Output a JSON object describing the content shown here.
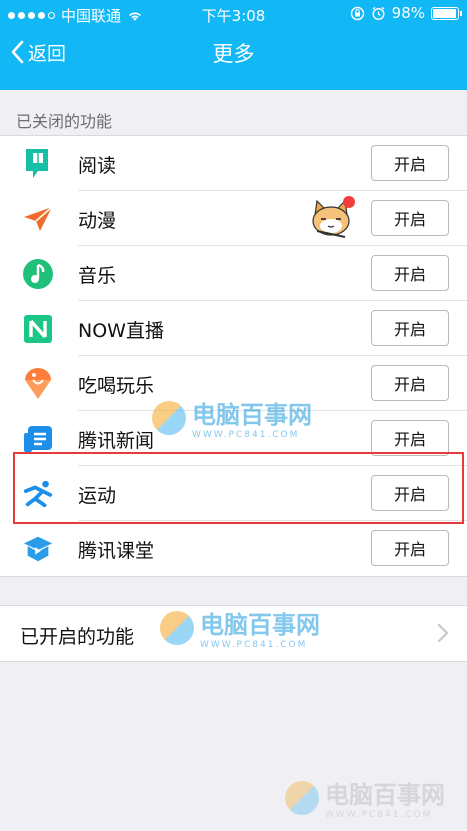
{
  "status": {
    "carrier": "中国联通",
    "time": "下午3:08",
    "battery": "98%",
    "battery_level": 0.98
  },
  "nav": {
    "back_label": "返回",
    "title": "更多"
  },
  "closed_section_label": "已关闭的功能",
  "features": [
    {
      "label": "阅读",
      "button": "开启",
      "icon": "book-icon"
    },
    {
      "label": "动漫",
      "button": "开启",
      "icon": "paper-plane-icon"
    },
    {
      "label": "音乐",
      "button": "开启",
      "icon": "music-note-icon"
    },
    {
      "label": "NOW直播",
      "button": "开启",
      "icon": "now-live-icon"
    },
    {
      "label": "吃喝玩乐",
      "button": "开启",
      "icon": "ice-cream-icon"
    },
    {
      "label": "腾讯新闻",
      "button": "开启",
      "icon": "news-icon"
    },
    {
      "label": "运动",
      "button": "开启",
      "icon": "running-icon"
    },
    {
      "label": "腾讯课堂",
      "button": "开启",
      "icon": "classroom-icon"
    }
  ],
  "enabled_row_label": "已开启的功能",
  "watermark": {
    "text": "电脑百事网",
    "sub": "WWW.PC841.COM"
  },
  "colors": {
    "header": "#12b7f5",
    "highlight_border": "#e83a3a"
  }
}
